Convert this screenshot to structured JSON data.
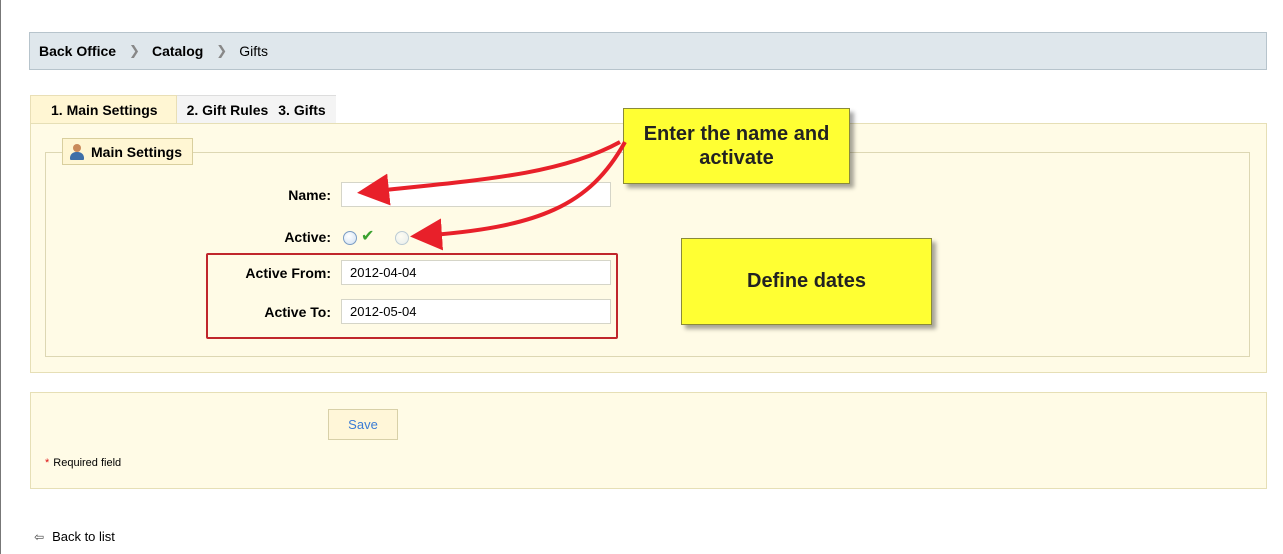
{
  "breadcrumb": {
    "items": [
      "Back Office",
      "Catalog",
      "Gifts"
    ],
    "separator": ">"
  },
  "tabs": [
    {
      "label": "1. Main Settings",
      "active": true
    },
    {
      "label": "2. Gift Rules",
      "active": false
    },
    {
      "label": "3. Gifts",
      "active": false
    }
  ],
  "section": {
    "legend": "Main Settings",
    "legend_icon": "user-icon"
  },
  "form": {
    "name_label": "Name:",
    "name_value": "",
    "active_label": "Active:",
    "active_from_label": "Active From:",
    "active_from_value": "2012-04-04",
    "active_to_label": "Active To:",
    "active_to_value": "2012-05-04"
  },
  "annotations": {
    "note1": "Enter the name and activate",
    "note2": "Define dates"
  },
  "actions": {
    "save_label": "Save",
    "required_star": "*",
    "required_text": "Required field",
    "back_label": "Back to list"
  },
  "colors": {
    "breadcrumb_bg": "#dfe7ec",
    "panel_bg": "#fffbe6",
    "note_bg": "#ffff33",
    "highlight_red": "#c0262c",
    "arrow_red": "#e8202a"
  }
}
